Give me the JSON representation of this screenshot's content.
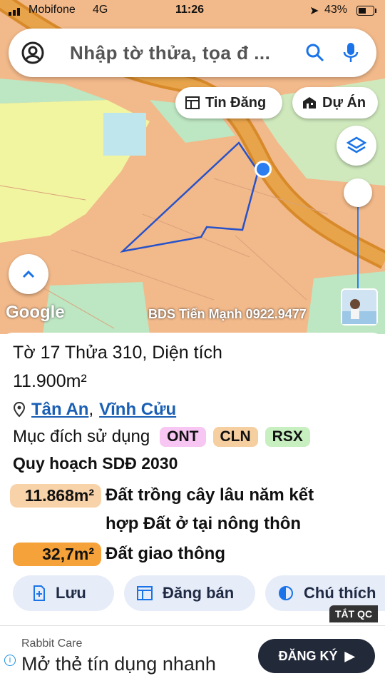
{
  "status": {
    "carrier": "Mobifone",
    "network": "4G",
    "time": "11:26",
    "battery": "43%"
  },
  "search": {
    "placeholder": "Nhập tờ thửa, tọa đ ..."
  },
  "chips": {
    "news": "Tin Đăng",
    "project": "Dự Án"
  },
  "map": {
    "google_label": "Google",
    "watermark": "BDS Tiến Mạnh 0922.9477"
  },
  "parcel": {
    "title": "Tờ 17 Thửa 310, Diện tích",
    "area": "11.900m²",
    "ward": "Tân An",
    "separator": ",",
    "district": "Vĩnh Cửu",
    "purpose_label": "Mục đích sử dụng",
    "purposes": [
      {
        "code": "ONT",
        "color": "#f7c6f2"
      },
      {
        "code": "CLN",
        "color": "#f6cfa0"
      },
      {
        "code": "RSX",
        "color": "#c8efc0"
      }
    ],
    "plan_title": "Quy hoạch SDĐ 2030",
    "plan_items": [
      {
        "value": "11.868m²",
        "line1": "Đất trồng cây lâu năm kết",
        "line2": "hợp Đất ở tại nông thôn",
        "color": "#f8d3aa"
      },
      {
        "value": "32,7m²",
        "line1": "Đất giao thông",
        "line2": "",
        "color": "#f5a23a"
      }
    ]
  },
  "actions": {
    "save": "Lưu",
    "sell": "Đăng bán",
    "legend": "Chú thích"
  },
  "ad_close": "TẮT QC",
  "ad": {
    "brand": "Rabbit Care",
    "text": "Mở thẻ tín dụng nhanh",
    "button": "ĐĂNG KÝ"
  }
}
